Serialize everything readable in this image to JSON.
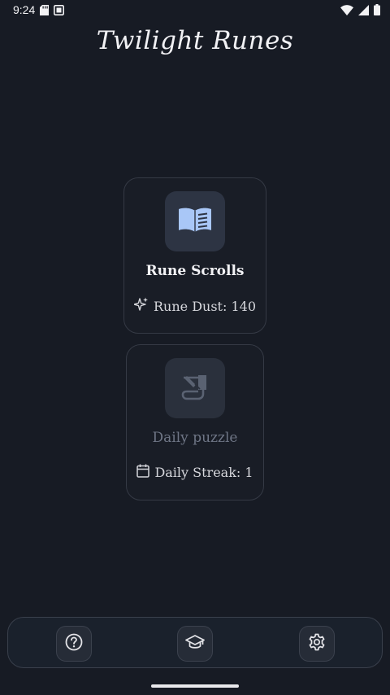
{
  "status_bar": {
    "time": "9:24",
    "icons": [
      "sd-card-icon",
      "screen-icon",
      "wifi-icon",
      "signal-icon",
      "battery-icon"
    ]
  },
  "app": {
    "title": "Twilight Runes"
  },
  "modes": [
    {
      "title": "Rune Scrolls",
      "icon": "open-book-icon",
      "stat_icon": "sparkles-icon",
      "stat_text": "Rune Dust: 140",
      "enabled": true
    },
    {
      "title": "Daily puzzle",
      "icon": "scroll-quill-icon",
      "stat_icon": "calendar-icon",
      "stat_text": "Daily Streak: 1",
      "enabled": false
    }
  ],
  "bottom_nav": {
    "items": [
      {
        "icon": "help-icon"
      },
      {
        "icon": "graduation-cap-icon"
      },
      {
        "icon": "gear-icon"
      }
    ]
  },
  "colors": {
    "background": "#171b24",
    "card_border": "#353a45",
    "icon_accent": "#a9c7f7",
    "muted_text": "#6f7686"
  }
}
